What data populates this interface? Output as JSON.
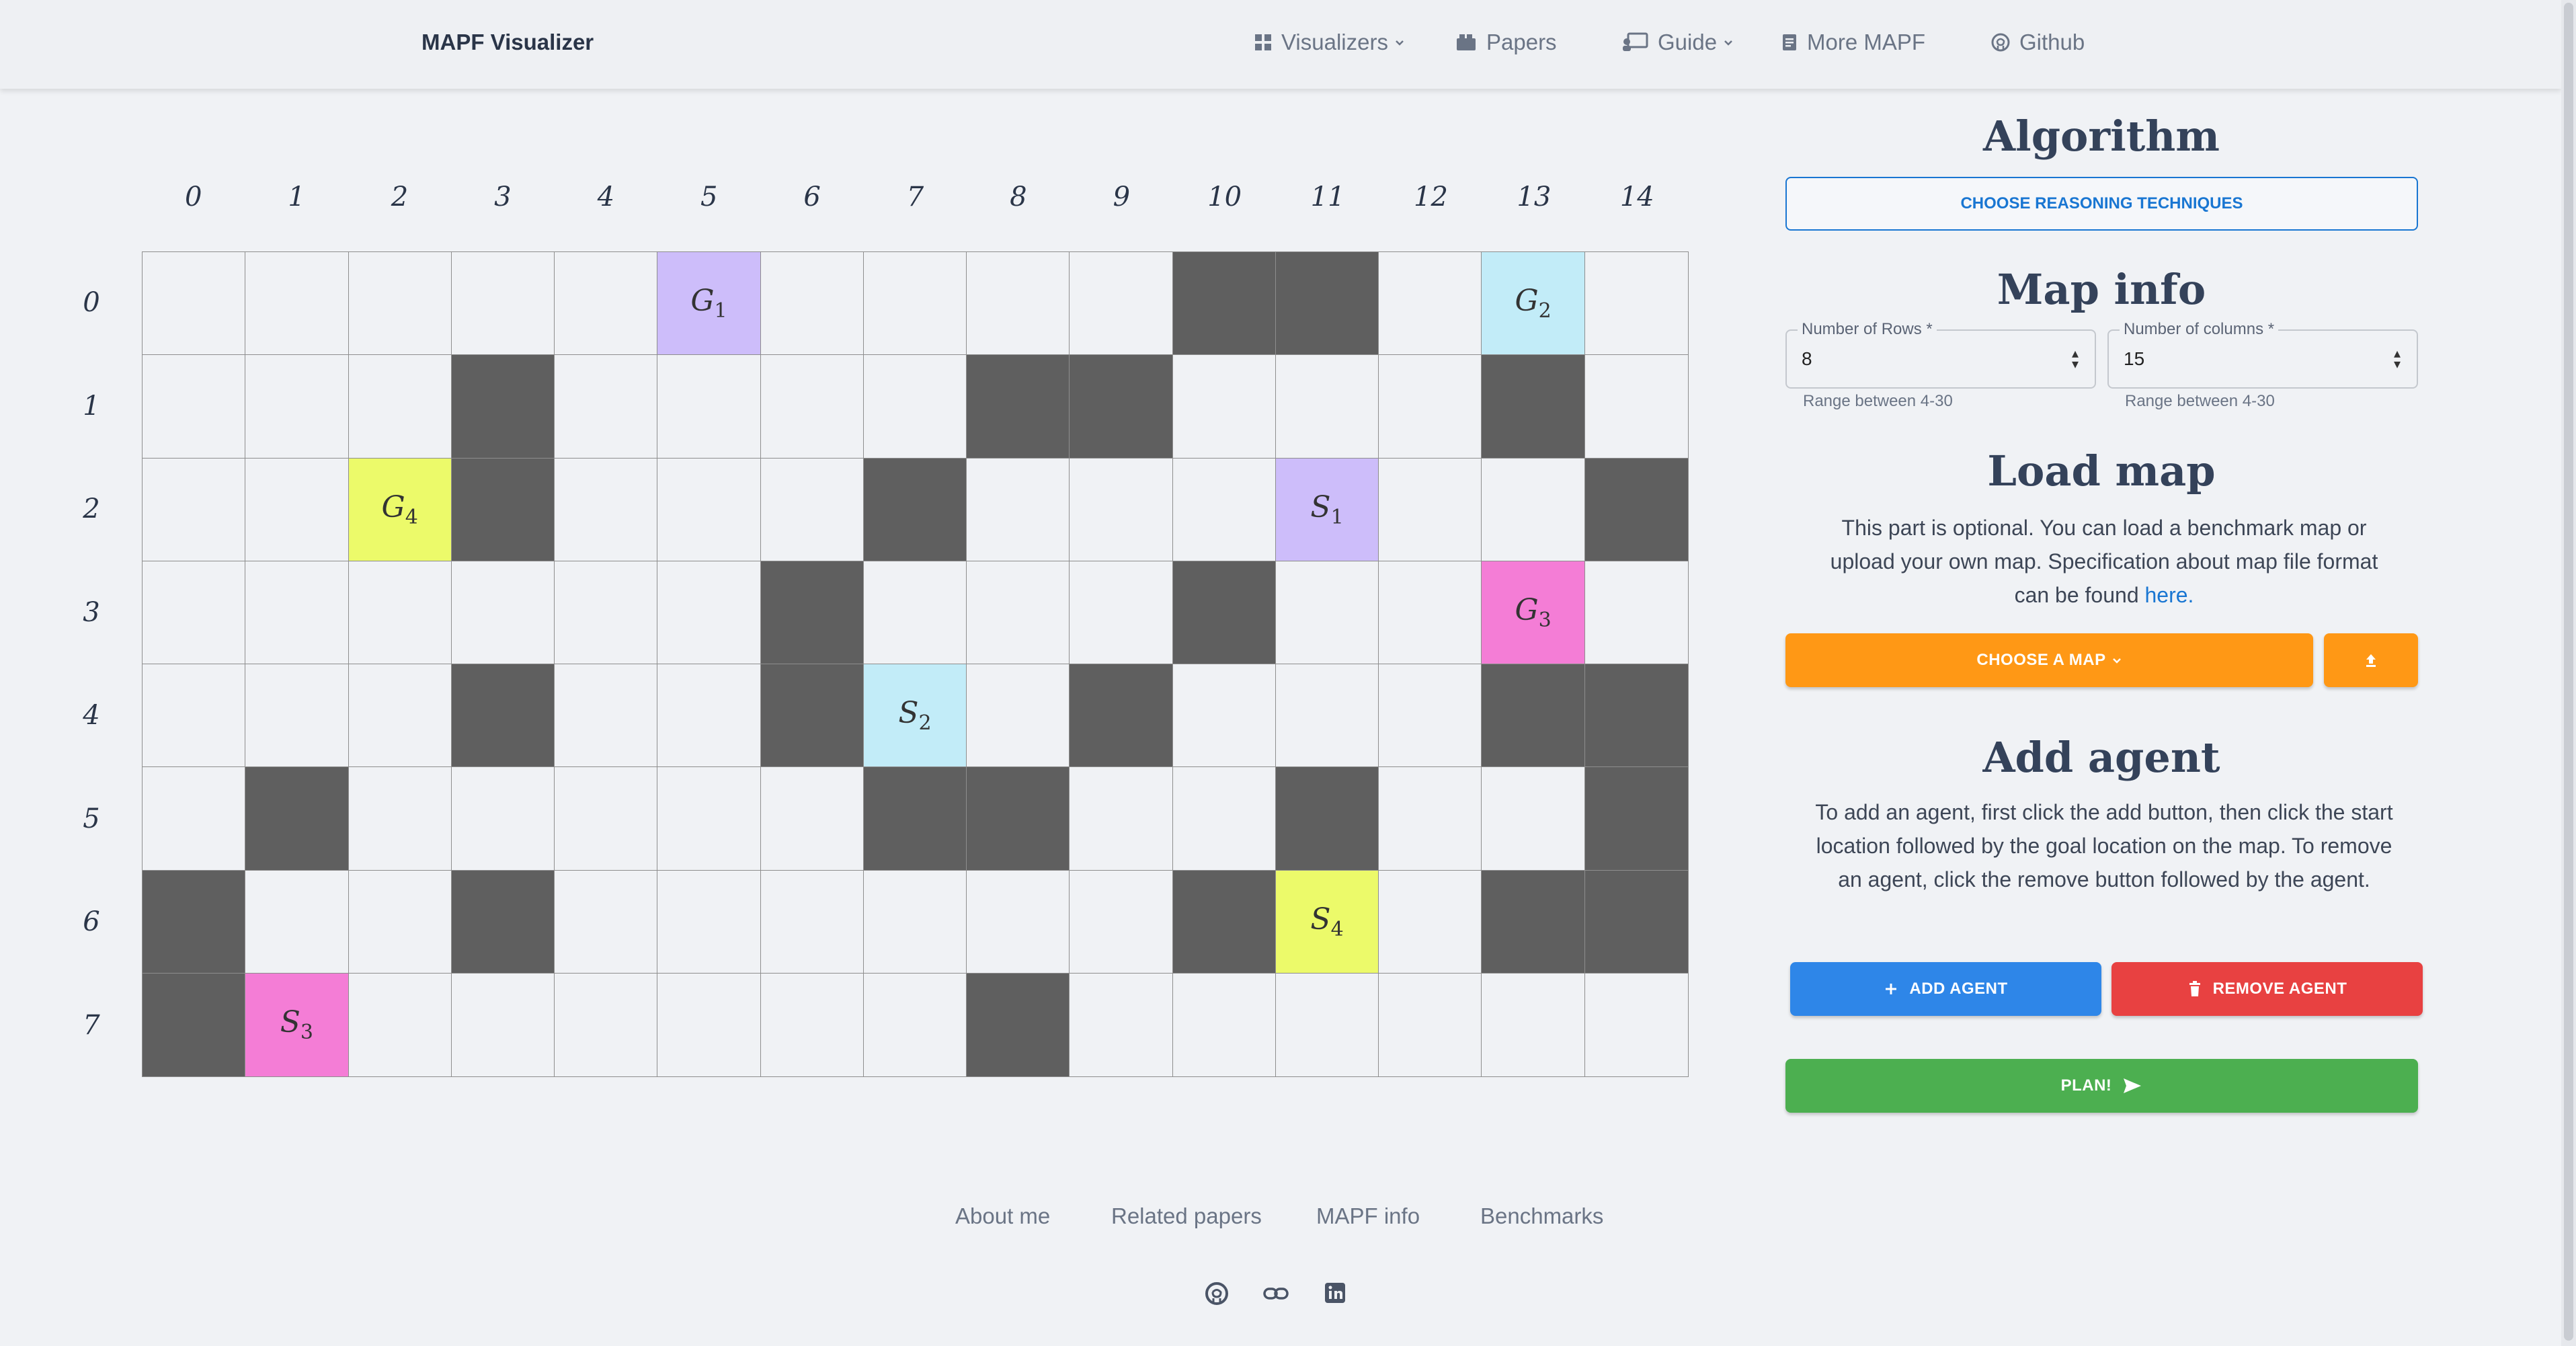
{
  "navbar": {
    "brand": "MAPF Visualizer",
    "items": [
      {
        "label": "Visualizers",
        "icon": "grid-icon",
        "dropdown": true
      },
      {
        "label": "Papers",
        "icon": "papers-icon",
        "dropdown": false
      },
      {
        "label": "Guide",
        "icon": "guide-icon",
        "dropdown": true
      },
      {
        "label": "More MAPF",
        "icon": "document-icon",
        "dropdown": false
      },
      {
        "label": "Github",
        "icon": "github-icon",
        "dropdown": false
      }
    ]
  },
  "grid": {
    "rows": 8,
    "cols": 15,
    "col_labels": [
      "0",
      "1",
      "2",
      "3",
      "4",
      "5",
      "6",
      "7",
      "8",
      "9",
      "10",
      "11",
      "12",
      "13",
      "14"
    ],
    "row_labels": [
      "0",
      "1",
      "2",
      "3",
      "4",
      "5",
      "6",
      "7"
    ],
    "obstacle_color": "#5f5f5f",
    "empty_color": "#f0f2f5",
    "obstacles": [
      [
        0,
        10
      ],
      [
        0,
        11
      ],
      [
        1,
        3
      ],
      [
        1,
        8
      ],
      [
        1,
        9
      ],
      [
        1,
        13
      ],
      [
        2,
        3
      ],
      [
        2,
        7
      ],
      [
        2,
        14
      ],
      [
        3,
        6
      ],
      [
        3,
        10
      ],
      [
        4,
        3
      ],
      [
        4,
        6
      ],
      [
        4,
        9
      ],
      [
        4,
        13
      ],
      [
        4,
        14
      ],
      [
        5,
        1
      ],
      [
        5,
        7
      ],
      [
        5,
        8
      ],
      [
        5,
        11
      ],
      [
        5,
        14
      ],
      [
        6,
        0
      ],
      [
        6,
        3
      ],
      [
        6,
        10
      ],
      [
        6,
        13
      ],
      [
        6,
        14
      ],
      [
        7,
        0
      ],
      [
        7,
        8
      ]
    ],
    "agents": [
      {
        "id": 1,
        "color": "#cdbdfa",
        "start": [
          2,
          11
        ],
        "goal": [
          0,
          5
        ],
        "start_label": "S",
        "goal_label": "G",
        "index": "1"
      },
      {
        "id": 2,
        "color": "#c2ecf8",
        "start": [
          4,
          7
        ],
        "goal": [
          0,
          13
        ],
        "start_label": "S",
        "goal_label": "G",
        "index": "2"
      },
      {
        "id": 3,
        "color": "#f47dd6",
        "start": [
          7,
          1
        ],
        "goal": [
          3,
          13
        ],
        "start_label": "S",
        "goal_label": "G",
        "index": "3"
      },
      {
        "id": 4,
        "color": "#ecfa6a",
        "start": [
          6,
          11
        ],
        "goal": [
          2,
          2
        ],
        "start_label": "S",
        "goal_label": "G",
        "index": "4"
      }
    ]
  },
  "panel": {
    "algorithm_title": "Algorithm",
    "reasoning_button": "CHOOSE REASONING TECHNIQUES",
    "map_info_title": "Map info",
    "rows_label": "Number of Rows *",
    "rows_value": "8",
    "rows_helper": "Range between 4-30",
    "cols_label": "Number of columns *",
    "cols_value": "15",
    "cols_helper": "Range between 4-30",
    "load_map_title": "Load map",
    "load_map_text": "This part is optional. You can load a benchmark map or upload your own map. Specification about map file format can be found",
    "load_map_link": "here.",
    "choose_map_button": "CHOOSE A MAP",
    "add_agent_title": "Add agent",
    "add_agent_text": "To add an agent, first click the add button, then click the start location followed by the goal location on the map. To remove an agent, click the remove button followed by the agent.",
    "add_agent_button": "ADD AGENT",
    "remove_agent_button": "REMOVE AGENT",
    "plan_button": "PLAN!",
    "orange": "#ff9815",
    "blue": "#2e86e8",
    "red": "#e84141",
    "green": "#4caf50"
  },
  "footer": {
    "links": [
      "About me",
      "Related papers",
      "MAPF info",
      "Benchmarks"
    ],
    "icons": [
      "github-icon",
      "link-icon",
      "linkedin-icon"
    ]
  }
}
